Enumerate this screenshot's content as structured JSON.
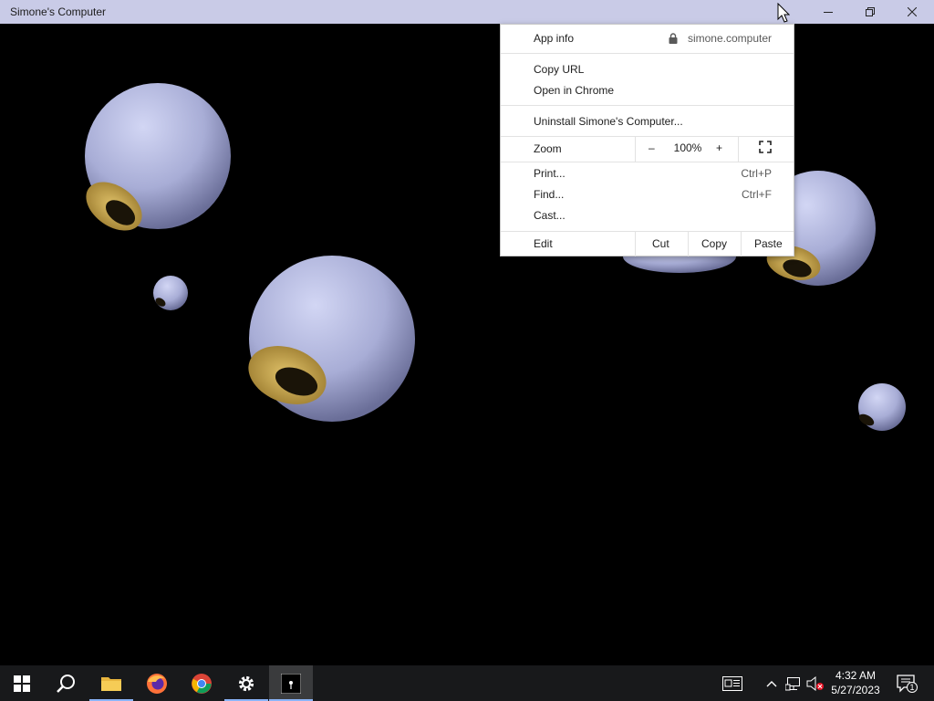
{
  "window": {
    "title": "Simone's Computer"
  },
  "menu": {
    "app_info": "App info",
    "origin": "simone.computer",
    "copy_url": "Copy URL",
    "open_in_chrome": "Open in Chrome",
    "uninstall": "Uninstall Simone's Computer...",
    "zoom_label": "Zoom",
    "zoom_minus": "–",
    "zoom_value": "100%",
    "zoom_plus": "+",
    "print": "Print...",
    "print_shortcut": "Ctrl+P",
    "find": "Find...",
    "find_shortcut": "Ctrl+F",
    "cast": "Cast...",
    "edit_label": "Edit",
    "cut": "Cut",
    "copy": "Copy",
    "paste": "Paste"
  },
  "taskbar": {
    "time": "4:32 AM",
    "date": "5/27/2023",
    "notification_count": "1"
  },
  "colors": {
    "titlebar": "#c9cbe7",
    "taskbar": "#18191b",
    "sphere": "#b4b9e0",
    "eye": "#d6b35a"
  }
}
